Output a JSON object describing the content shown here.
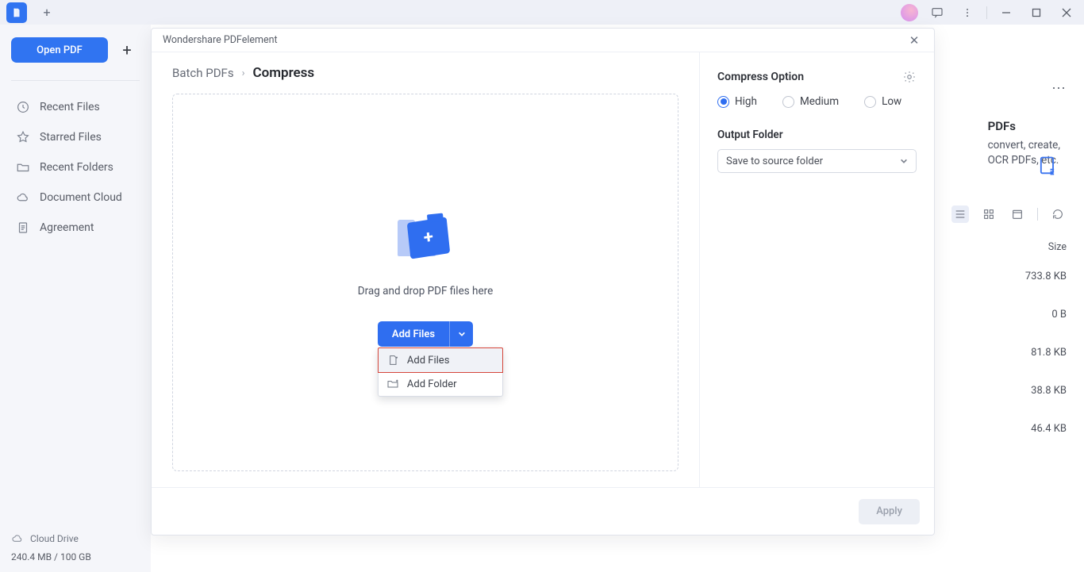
{
  "titlebar": {
    "new_tab": "+"
  },
  "sidebar": {
    "open_pdf": "Open PDF",
    "items": [
      {
        "label": "Recent Files"
      },
      {
        "label": "Starred Files"
      },
      {
        "label": "Recent Folders"
      },
      {
        "label": "Document Cloud"
      },
      {
        "label": "Agreement"
      }
    ],
    "cloud_drive": "Cloud Drive",
    "storage": "240.4 MB / 100 GB"
  },
  "content": {
    "card_title": "PDFs",
    "card_line1": "convert, create,",
    "card_line2": "OCR PDFs, etc.",
    "col_size": "Size",
    "rows": [
      {
        "size": "733.8 KB"
      },
      {
        "size": "0 B"
      },
      {
        "size": "81.8 KB"
      },
      {
        "size": "38.8 KB"
      },
      {
        "size": "46.4 KB"
      }
    ]
  },
  "modal": {
    "title": "Wondershare PDFelement",
    "breadcrumb_parent": "Batch PDFs",
    "breadcrumb_current": "Compress",
    "drop_text": "Drag and drop PDF files here",
    "add_files": "Add Files",
    "dropdown": {
      "add_files": "Add Files",
      "add_folder": "Add Folder"
    },
    "compress_option": "Compress Option",
    "radios": {
      "high": "High",
      "medium": "Medium",
      "low": "Low"
    },
    "output_folder": "Output Folder",
    "select_value": "Save to source folder",
    "apply": "Apply"
  }
}
